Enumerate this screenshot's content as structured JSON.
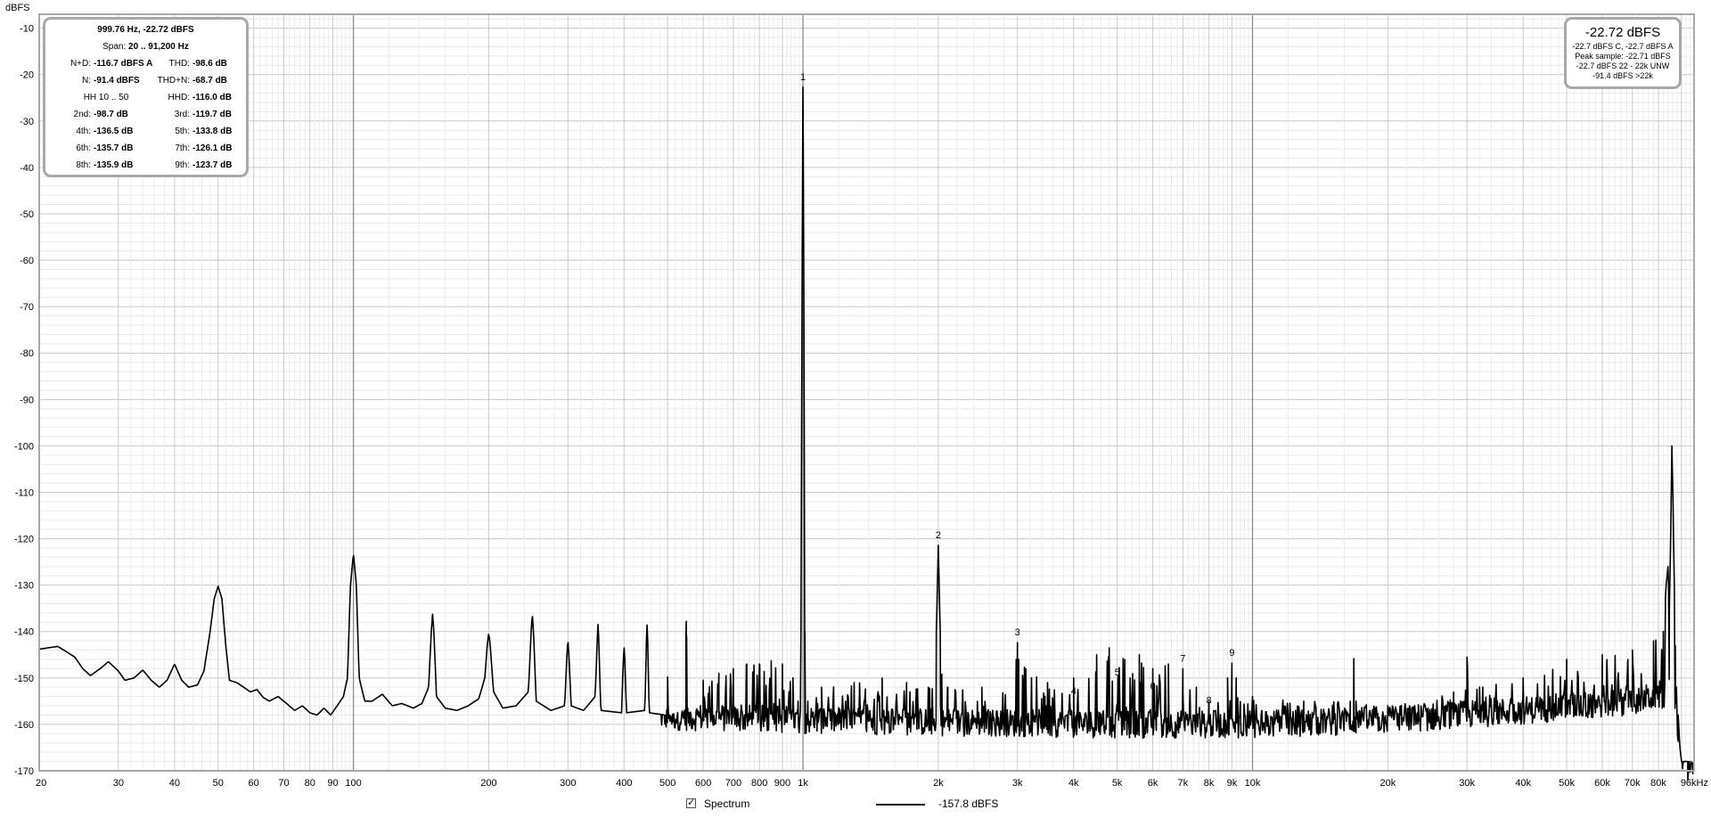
{
  "stats_panel": {
    "title": "999.76 Hz, -22.72 dBFS",
    "span_label": "Span:",
    "span_value": "20 .. 91,200 Hz",
    "rows": [
      {
        "l1": "N+D:",
        "v1": "-116.7 dBFS A",
        "l2": "THD:",
        "v2": "-98.6 dB"
      },
      {
        "l1": "N:",
        "v1": "-91.4 dBFS",
        "l2": "THD+N:",
        "v2": "-68.7 dB"
      },
      {
        "l1": "",
        "v1": "",
        "l2": "HHD:",
        "v2": "-116.0 dB"
      },
      {
        "l1": "2nd:",
        "v1": "-98.7 dB",
        "l2": "3rd:",
        "v2": "-119.7 dB"
      },
      {
        "l1": "4th:",
        "v1": "-136.5 dB",
        "l2": "5th:",
        "v2": "-133.8 dB"
      },
      {
        "l1": "6th:",
        "v1": "-135.7 dB",
        "l2": "7th:",
        "v2": "-126.1 dB"
      },
      {
        "l1": "8th:",
        "v1": "-135.9 dB",
        "l2": "9th:",
        "v2": "-123.7 dB"
      }
    ],
    "hh_text": "HH 10 .. 50"
  },
  "level_panel": {
    "main": "-22.72 dBFS",
    "lines": [
      "-22.7 dBFS C, -22.7 dBFS A",
      "Peak sample: -22.71 dBFS",
      "-22.7 dBFS 22 - 22k UNW",
      "-91.4 dBFS >22k"
    ]
  },
  "legend": {
    "checked": true,
    "checkbox_glyph": "✓",
    "series_name": "Spectrum",
    "value_text": "-157.8 dBFS",
    "color": "#000000"
  },
  "chart_data": {
    "type": "line",
    "x_scale": "log",
    "ylabel": "dBFS",
    "xlim": [
      20,
      96000
    ],
    "ylim": [
      -170,
      -7
    ],
    "grid": true,
    "y_ticks": [
      -10,
      -20,
      -30,
      -40,
      -50,
      -60,
      -70,
      -80,
      -90,
      -100,
      -110,
      -120,
      -130,
      -140,
      -150,
      -160,
      -170
    ],
    "x_tick_labels": [
      {
        "f": 20,
        "t": "20"
      },
      {
        "f": 30,
        "t": "30"
      },
      {
        "f": 40,
        "t": "40"
      },
      {
        "f": 50,
        "t": "50"
      },
      {
        "f": 60,
        "t": "60"
      },
      {
        "f": 70,
        "t": "70"
      },
      {
        "f": 80,
        "t": "80"
      },
      {
        "f": 90,
        "t": "90"
      },
      {
        "f": 100,
        "t": "100"
      },
      {
        "f": 200,
        "t": "200"
      },
      {
        "f": 300,
        "t": "300"
      },
      {
        "f": 400,
        "t": "400"
      },
      {
        "f": 500,
        "t": "500"
      },
      {
        "f": 600,
        "t": "600"
      },
      {
        "f": 700,
        "t": "700"
      },
      {
        "f": 800,
        "t": "800"
      },
      {
        "f": 900,
        "t": "900"
      },
      {
        "f": 1000,
        "t": "1k"
      },
      {
        "f": 2000,
        "t": "2k"
      },
      {
        "f": 3000,
        "t": "3k"
      },
      {
        "f": 4000,
        "t": "4k"
      },
      {
        "f": 5000,
        "t": "5k"
      },
      {
        "f": 6000,
        "t": "6k"
      },
      {
        "f": 7000,
        "t": "7k"
      },
      {
        "f": 8000,
        "t": "8k"
      },
      {
        "f": 9000,
        "t": "9k"
      },
      {
        "f": 10000,
        "t": "10k"
      },
      {
        "f": 20000,
        "t": "20k"
      },
      {
        "f": 30000,
        "t": "30k"
      },
      {
        "f": 40000,
        "t": "40k"
      },
      {
        "f": 50000,
        "t": "50k"
      },
      {
        "f": 60000,
        "t": "60k"
      },
      {
        "f": 70000,
        "t": "70k"
      },
      {
        "f": 80000,
        "t": "80k"
      },
      {
        "f": 96000,
        "t": "96kHz"
      }
    ],
    "harmonic_markers": [
      {
        "label": "1",
        "f": 1000,
        "db": -22.7
      },
      {
        "label": "2",
        "f": 2000,
        "db": -121.4
      },
      {
        "label": "3",
        "f": 3000,
        "db": -142.4
      },
      {
        "label": "4",
        "f": 4000,
        "db": -155.0
      },
      {
        "label": "5",
        "f": 5000,
        "db": -151.0
      },
      {
        "label": "6",
        "f": 6000,
        "db": -154.0
      },
      {
        "label": "7",
        "f": 7000,
        "db": -148.0
      },
      {
        "label": "8",
        "f": 8000,
        "db": -157.0
      },
      {
        "label": "9",
        "f": 9000,
        "db": -146.8
      }
    ],
    "series": [
      {
        "name": "Spectrum",
        "color": "#000000",
        "envelope": [
          [
            20,
            -143.8
          ],
          [
            22,
            -143.2
          ],
          [
            24,
            -145.5
          ],
          [
            25,
            -148
          ],
          [
            26,
            -149.5
          ],
          [
            27.5,
            -147.8
          ],
          [
            28.5,
            -146.5
          ],
          [
            30,
            -148.5
          ],
          [
            31,
            -150.5
          ],
          [
            32.5,
            -150
          ],
          [
            34,
            -148.3
          ],
          [
            35.5,
            -150.5
          ],
          [
            37,
            -152
          ],
          [
            38.5,
            -150.5
          ],
          [
            40,
            -147
          ],
          [
            41.5,
            -150.5
          ],
          [
            43,
            -152
          ],
          [
            45,
            -151.5
          ],
          [
            46.5,
            -148.5
          ],
          [
            48,
            -140
          ],
          [
            49,
            -133
          ],
          [
            50,
            -130.2
          ],
          [
            51,
            -133
          ],
          [
            52,
            -143
          ],
          [
            53,
            -150.5
          ],
          [
            55,
            -151
          ],
          [
            57,
            -152
          ],
          [
            59,
            -153
          ],
          [
            61,
            -152.5
          ],
          [
            63,
            -154.2
          ],
          [
            65,
            -155
          ],
          [
            68,
            -154
          ],
          [
            71,
            -155.5
          ],
          [
            74,
            -157
          ],
          [
            77,
            -156
          ],
          [
            80,
            -157.5
          ],
          [
            83,
            -158
          ],
          [
            86,
            -156.5
          ],
          [
            89,
            -158
          ],
          [
            92,
            -156
          ],
          [
            95,
            -154
          ],
          [
            97,
            -150
          ],
          [
            98.5,
            -130
          ],
          [
            100,
            -123.2
          ],
          [
            101.5,
            -130
          ],
          [
            103,
            -150
          ],
          [
            106,
            -155
          ],
          [
            110,
            -155
          ],
          [
            116,
            -153.5
          ],
          [
            122,
            -156
          ],
          [
            128,
            -155.5
          ],
          [
            136,
            -156.5
          ],
          [
            142,
            -155.5
          ],
          [
            147,
            -152
          ],
          [
            149,
            -140
          ],
          [
            150,
            -136.2
          ],
          [
            151,
            -140
          ],
          [
            153,
            -154
          ],
          [
            160,
            -156.5
          ],
          [
            170,
            -157
          ],
          [
            180,
            -156
          ],
          [
            190,
            -154.5
          ],
          [
            196,
            -150
          ],
          [
            198.5,
            -143
          ],
          [
            200,
            -140.3
          ],
          [
            201.5,
            -143
          ],
          [
            205,
            -153
          ],
          [
            215,
            -156.5
          ],
          [
            230,
            -156
          ],
          [
            245,
            -153
          ],
          [
            248.5,
            -140
          ],
          [
            250,
            -136.2
          ],
          [
            251.5,
            -140
          ],
          [
            255,
            -155
          ],
          [
            275,
            -157
          ],
          [
            295,
            -156
          ],
          [
            298.5,
            -145
          ],
          [
            300,
            -141.6
          ],
          [
            301.5,
            -145
          ],
          [
            305,
            -156
          ],
          [
            325,
            -157
          ],
          [
            345,
            -154
          ],
          [
            348.5,
            -142
          ],
          [
            350,
            -138.3
          ],
          [
            351.5,
            -142
          ],
          [
            355,
            -157
          ],
          [
            395,
            -157.5
          ],
          [
            398.5,
            -146
          ],
          [
            400,
            -143.3
          ],
          [
            401.5,
            -146
          ],
          [
            405,
            -157.5
          ],
          [
            445,
            -157
          ],
          [
            448.5,
            -142
          ],
          [
            450,
            -138.5
          ],
          [
            451.5,
            -142
          ],
          [
            455,
            -157.5
          ],
          [
            495,
            -158
          ],
          [
            500,
            -149.8
          ],
          [
            505,
            -158
          ],
          [
            545,
            -157
          ],
          [
            549,
            -141
          ],
          [
            550,
            -137.8
          ],
          [
            551,
            -141
          ],
          [
            555,
            -158
          ],
          [
            600,
            -150.5
          ],
          [
            650,
            -149
          ],
          [
            700,
            -148
          ],
          [
            750,
            -147
          ],
          [
            800,
            -147
          ],
          [
            850,
            -146.3
          ],
          [
            900,
            -147
          ],
          [
            950,
            -150
          ],
          [
            975,
            -155
          ],
          [
            990,
            -140
          ],
          [
            996,
            -60
          ],
          [
            1000,
            -22.7
          ],
          [
            1004,
            -60
          ],
          [
            1010,
            -140
          ],
          [
            1025,
            -155
          ],
          [
            1100,
            -152
          ],
          [
            1300,
            -151
          ],
          [
            1500,
            -150
          ],
          [
            1700,
            -151
          ],
          [
            1900,
            -152
          ],
          [
            1980,
            -140
          ],
          [
            2000,
            -121.4
          ],
          [
            2020,
            -140
          ],
          [
            2100,
            -152
          ],
          [
            2500,
            -152
          ],
          [
            2980,
            -146
          ],
          [
            3000,
            -142.4
          ],
          [
            3020,
            -146
          ],
          [
            3500,
            -151
          ],
          [
            4000,
            -150
          ],
          [
            4500,
            -145
          ],
          [
            4800,
            -143.5
          ],
          [
            5200,
            -146
          ],
          [
            5600,
            -145
          ],
          [
            6000,
            -148
          ],
          [
            6500,
            -147
          ],
          [
            7000,
            -148
          ],
          [
            7500,
            -152
          ],
          [
            8000,
            -155
          ],
          [
            8800,
            -150
          ],
          [
            9000,
            -146.8
          ],
          [
            9200,
            -150
          ],
          [
            10000,
            -154
          ],
          [
            13000,
            -155
          ],
          [
            16500,
            -155
          ],
          [
            16800,
            -145.8
          ],
          [
            17000,
            -155
          ],
          [
            20000,
            -156
          ],
          [
            28000,
            -153
          ],
          [
            30000,
            -145.5
          ],
          [
            32000,
            -152
          ],
          [
            40000,
            -150
          ],
          [
            50000,
            -146
          ],
          [
            60000,
            -145
          ],
          [
            70000,
            -144
          ],
          [
            78000,
            -142
          ],
          [
            82000,
            -140
          ],
          [
            83200,
            -130
          ],
          [
            84000,
            -126
          ],
          [
            84600,
            -135
          ],
          [
            85200,
            -118
          ],
          [
            85700,
            -100
          ],
          [
            86200,
            -112
          ],
          [
            86700,
            -128
          ],
          [
            87200,
            -143
          ],
          [
            87700,
            -152
          ],
          [
            88500,
            -158
          ],
          [
            90000,
            -168
          ],
          [
            93000,
            -172
          ]
        ],
        "noise_floor": [
          [
            20,
            -152
          ],
          [
            100,
            -155
          ],
          [
            300,
            -157.5
          ],
          [
            600,
            -158.5
          ],
          [
            1000,
            -159
          ],
          [
            2000,
            -159.5
          ],
          [
            5000,
            -160
          ],
          [
            10000,
            -160
          ],
          [
            20000,
            -159
          ],
          [
            40000,
            -157
          ],
          [
            70000,
            -155
          ],
          [
            86000,
            -153
          ],
          [
            88000,
            -160
          ],
          [
            90000,
            -168
          ]
        ]
      }
    ]
  }
}
